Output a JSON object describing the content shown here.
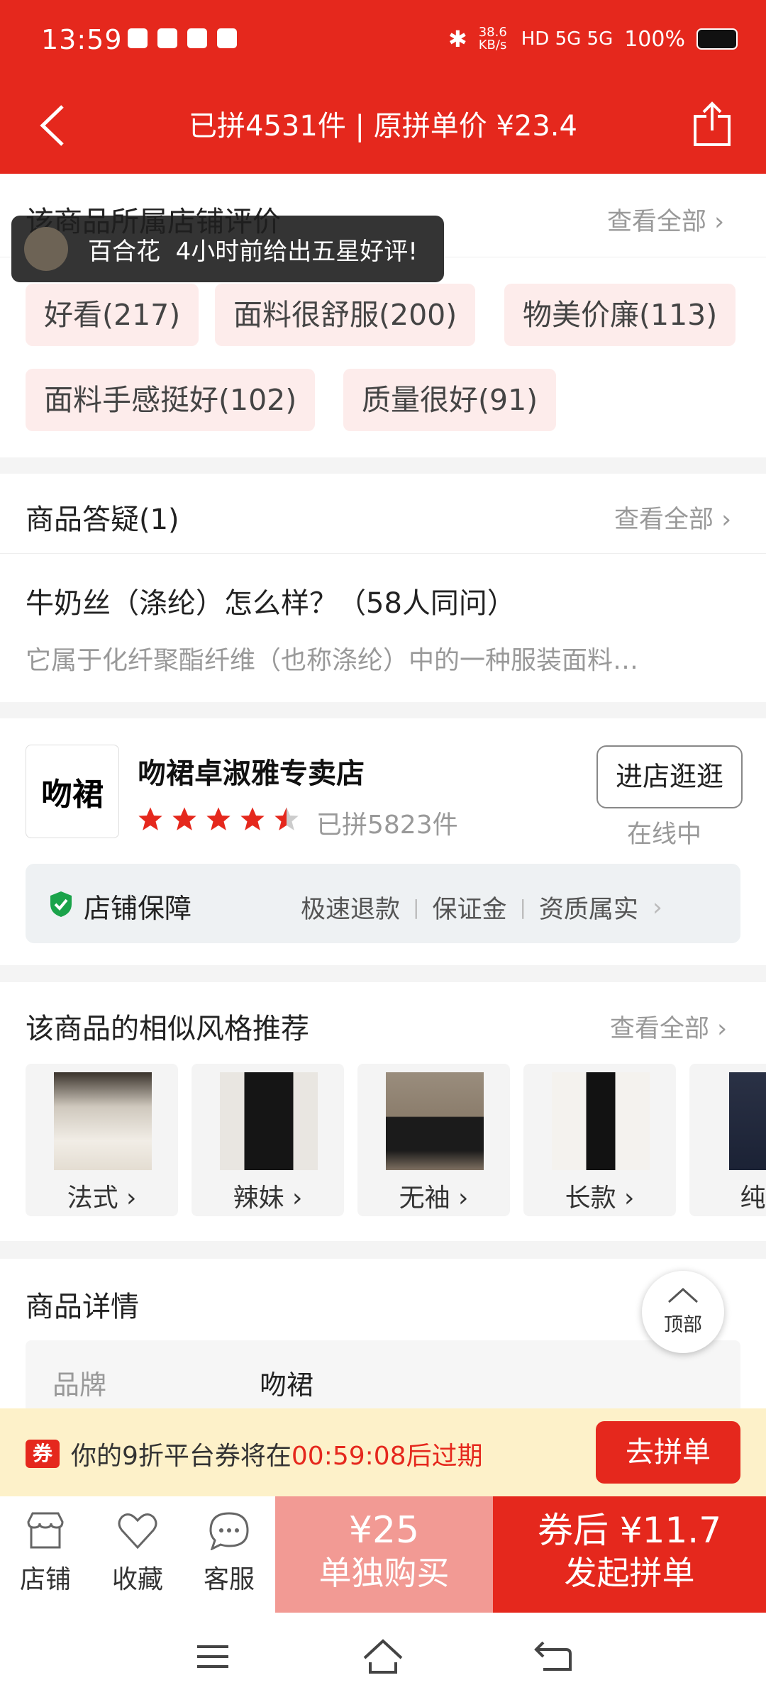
{
  "status_bar": {
    "time": "13:59",
    "net_speed": "38.6 KB/s",
    "battery": "100%"
  },
  "header": {
    "title": "已拼4531件 | 原拼单价 ¥23.4"
  },
  "reviews": {
    "title": "该商品所属店铺评价",
    "see_all": "查看全部",
    "toast": {
      "user": "百合花",
      "message": "4小时前给出五星好评!"
    },
    "tags": [
      "好看(217)",
      "面料很舒服(200)",
      "物美价廉(113)",
      "面料手感挺好(102)",
      "质量很好(91)"
    ]
  },
  "qa": {
    "title": "商品答疑(1)",
    "see_all": "查看全部",
    "question": "牛奶丝（涤纶）怎么样？（58人同问）",
    "answer": "它属于化纤聚酯纤维（也称涤纶）中的一种服装面料…"
  },
  "shop": {
    "logo_text": "吻裙",
    "name": "吻裙卓淑雅专卖店",
    "rating": 4.5,
    "sold": "已拼5823件",
    "enter_label": "进店逛逛",
    "online_status": "在线中",
    "guarantee": {
      "label": "店铺保障",
      "items": [
        "极速退款",
        "保证金",
        "资质属实"
      ]
    }
  },
  "recommend": {
    "title": "该商品的相似风格推荐",
    "see_all": "查看全部",
    "items": [
      {
        "label": "法式"
      },
      {
        "label": "辣妹"
      },
      {
        "label": "无袖"
      },
      {
        "label": "长款"
      },
      {
        "label": "纯色"
      }
    ]
  },
  "details": {
    "title": "商品详情",
    "brand_key": "品牌",
    "brand_value": "吻裙"
  },
  "top_button": {
    "label": "顶部"
  },
  "coupon": {
    "icon": "券",
    "prefix": "你的9折平台券将在",
    "countdown": "00:59:08",
    "suffix": "后过期",
    "button": "去拼单"
  },
  "bottom_bar": {
    "store": "店铺",
    "favorite": "收藏",
    "service": "客服",
    "alone_price": "¥25",
    "alone_label": "单独购买",
    "group_price": "券后 ¥11.7",
    "group_label": "发起拼单"
  },
  "colors": {
    "brand_red": "#e5281d",
    "tag_bg": "#fdeceb",
    "coupon_bg": "#fdf1c9",
    "alone_bg": "#f29a94"
  }
}
